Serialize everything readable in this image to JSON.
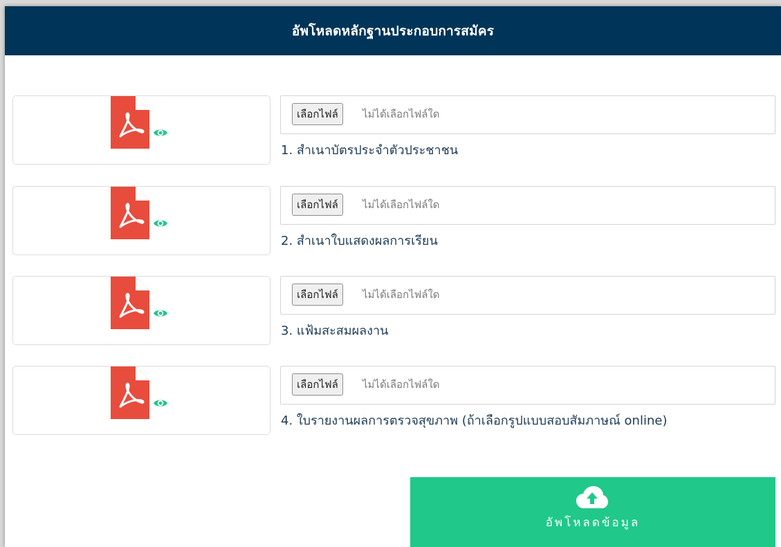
{
  "header": {
    "title": "อัพโหลดหลักฐานประกอบการสมัคร"
  },
  "colors": {
    "header_bg": "#003458",
    "pdf_red": "#e84c3d",
    "eye_green": "#20c88a",
    "upload_green": "#20c88a",
    "label_text": "#1f3b56"
  },
  "documents": [
    {
      "label": "1. สำเนาบัตรประจำตัวประชาชน",
      "file_button": "เลือกไฟล์",
      "file_status": "ไม่ได้เลือกไฟล์ใด",
      "preview_icon": "pdf-file-icon",
      "view_icon": "eye-icon"
    },
    {
      "label": "2. สำเนาใบแสดงผลการเรียน",
      "file_button": "เลือกไฟล์",
      "file_status": "ไม่ได้เลือกไฟล์ใด",
      "preview_icon": "pdf-file-icon",
      "view_icon": "eye-icon"
    },
    {
      "label": "3. แฟ้มสะสมผลงาน",
      "file_button": "เลือกไฟล์",
      "file_status": "ไม่ได้เลือกไฟล์ใด",
      "preview_icon": "pdf-file-icon",
      "view_icon": "eye-icon"
    },
    {
      "label": "4. ใบรายงานผลการตรวจสุขภาพ (ถ้าเลือกรูปแบบสอบสัมภาษณ์ online)",
      "file_button": "เลือกไฟล์",
      "file_status": "ไม่ได้เลือกไฟล์ใด",
      "preview_icon": "pdf-file-icon",
      "view_icon": "eye-icon"
    }
  ],
  "upload": {
    "label": "อัพโหลดข้อมูล",
    "icon": "cloud-upload-icon"
  }
}
